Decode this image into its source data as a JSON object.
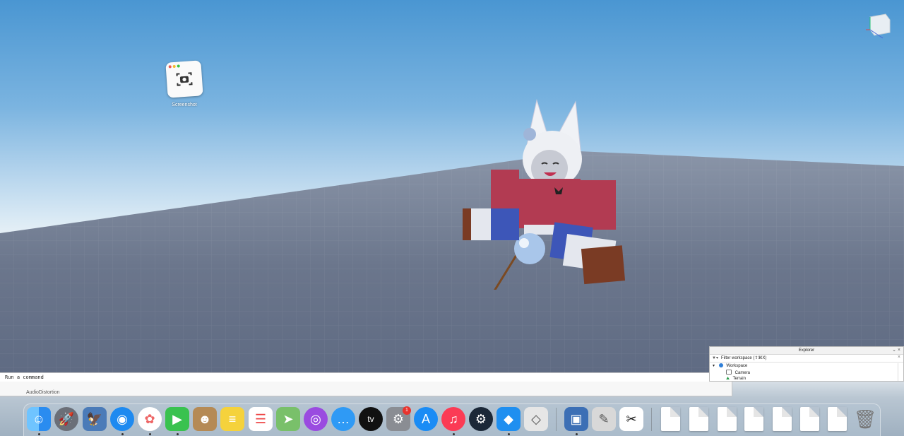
{
  "desktop": {
    "screenshot_icon_label": "Screenshot"
  },
  "viewport": {
    "gizmo_icon": "view-cube-icon",
    "character": "roblox-avatar"
  },
  "command_bar": {
    "placeholder": "Run a command"
  },
  "explorer": {
    "title": "Explorer",
    "filter_placeholder": "Filter workspace (⇧⌘X)",
    "items": [
      {
        "label": "Workspace",
        "depth": 0,
        "icon": "workspace-globe-icon"
      },
      {
        "label": "Camera",
        "depth": 1,
        "icon": "camera-icon"
      },
      {
        "label": "Terrain",
        "depth": 1,
        "icon": "terrain-icon"
      }
    ]
  },
  "properties_strip": {
    "text": "AudioDistortion"
  },
  "dock": {
    "apps": [
      {
        "name": "finder-icon",
        "color": "#2a8cf0"
      },
      {
        "name": "launchpad-icon",
        "color": "#6b6f78"
      },
      {
        "name": "preview-icon",
        "color": "#4b7bb8"
      },
      {
        "name": "safari-icon",
        "color": "#1e8af0"
      },
      {
        "name": "photos-icon",
        "color": "#ffffff"
      },
      {
        "name": "facetime-icon",
        "color": "#39c24f"
      },
      {
        "name": "contacts-icon",
        "color": "#b58a55"
      },
      {
        "name": "notes-icon",
        "color": "#f5d23c"
      },
      {
        "name": "reminders-icon",
        "color": "#ffffff"
      },
      {
        "name": "maps-icon",
        "color": "#79c06a"
      },
      {
        "name": "podcasts-icon",
        "color": "#9a4be0"
      },
      {
        "name": "messages-icon",
        "color": "#2f9af5"
      },
      {
        "name": "apple-tv-icon",
        "color": "#111111"
      },
      {
        "name": "system-settings-icon",
        "color": "#8a8d93"
      },
      {
        "name": "app-store-icon",
        "color": "#1a8cf5"
      },
      {
        "name": "music-icon",
        "color": "#fb3b55"
      },
      {
        "name": "steam-icon",
        "color": "#1b2838"
      },
      {
        "name": "roblox-studio-icon",
        "color": "#1f8ff0"
      },
      {
        "name": "roblox-icon",
        "color": "#e6e6e6"
      },
      {
        "name": "preview-doc-icon",
        "color": "#3c6fb5"
      },
      {
        "name": "script-editor-icon",
        "color": "#d8d8d8"
      },
      {
        "name": "capcut-icon",
        "color": "#ffffff"
      }
    ],
    "settings_badge": "1",
    "tv_label": "tv"
  }
}
